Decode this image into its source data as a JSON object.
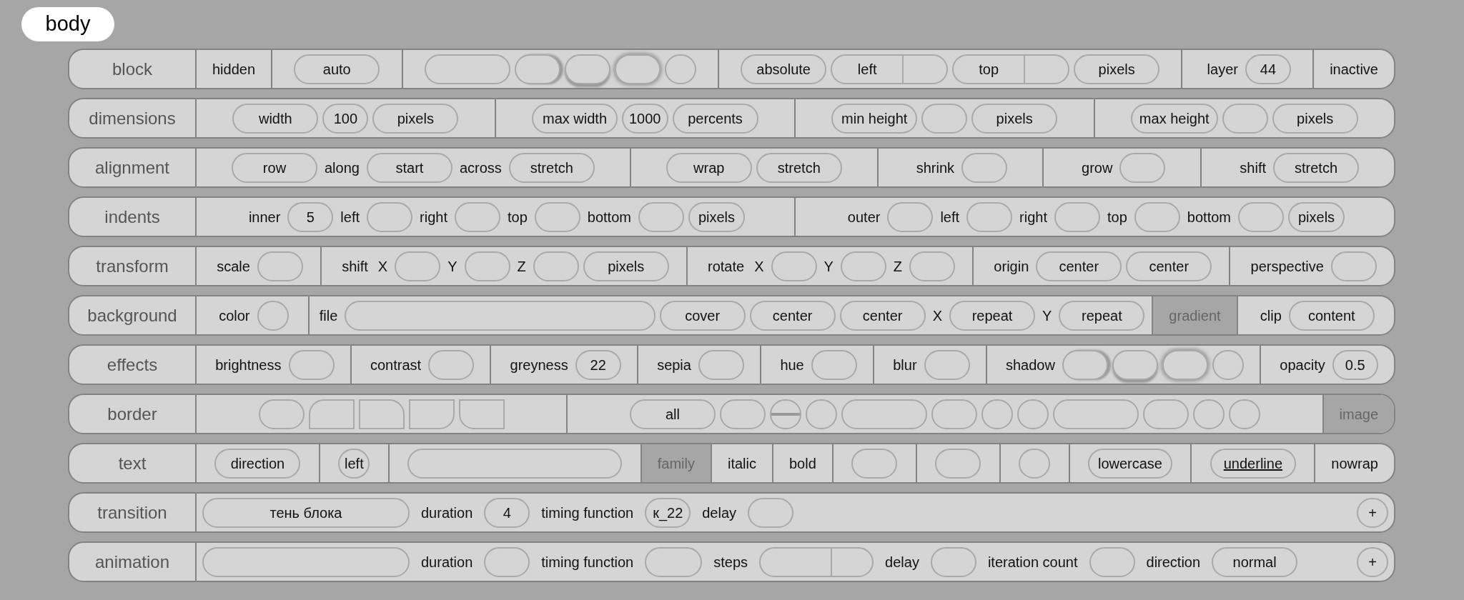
{
  "header": {
    "text": "body"
  },
  "rows": [
    {
      "label": "block",
      "sections": [
        {
          "kind": "toggle",
          "text": "hidden",
          "on": false
        },
        {
          "kind": "group",
          "items": [
            {
              "kind": "pill",
              "text": "auto"
            }
          ]
        },
        {
          "kind": "group",
          "items": [
            {
              "kind": "medium"
            },
            {
              "kind": "shadow-right"
            },
            {
              "kind": "shadow-below"
            },
            {
              "kind": "shadow-around"
            },
            {
              "kind": "dot"
            }
          ]
        },
        {
          "kind": "group",
          "items": [
            {
              "kind": "pill",
              "text": "absolute"
            },
            {
              "kind": "split",
              "text": "left"
            },
            {
              "kind": "split",
              "text": "top"
            },
            {
              "kind": "pill",
              "text": "pixels"
            }
          ]
        },
        {
          "kind": "group",
          "items": [
            {
              "kind": "text",
              "text": "layer"
            },
            {
              "kind": "short",
              "text": "44"
            }
          ]
        },
        {
          "kind": "toggle",
          "text": "inactive",
          "on": false
        }
      ]
    },
    {
      "label": "dimensions",
      "sections": [
        {
          "kind": "group",
          "items": [
            {
              "kind": "pill",
              "text": "width"
            },
            {
              "kind": "short",
              "text": "100"
            },
            {
              "kind": "pill",
              "text": "pixels"
            }
          ]
        },
        {
          "kind": "group",
          "items": [
            {
              "kind": "pill",
              "text": "max width"
            },
            {
              "kind": "short",
              "text": "1000"
            },
            {
              "kind": "pill",
              "text": "percents"
            }
          ]
        },
        {
          "kind": "group",
          "items": [
            {
              "kind": "pill",
              "text": "min height"
            },
            {
              "kind": "short"
            },
            {
              "kind": "pill",
              "text": "pixels"
            }
          ]
        },
        {
          "kind": "group",
          "items": [
            {
              "kind": "pill",
              "text": "max height"
            },
            {
              "kind": "short"
            },
            {
              "kind": "pill",
              "text": "pixels"
            }
          ]
        }
      ]
    },
    {
      "label": "alignment",
      "sections": [
        {
          "kind": "group",
          "items": [
            {
              "kind": "pill",
              "text": "row"
            },
            {
              "kind": "text",
              "text": "along"
            },
            {
              "kind": "pill",
              "text": "start"
            },
            {
              "kind": "text",
              "text": "across"
            },
            {
              "kind": "pill",
              "text": "stretch"
            }
          ]
        },
        {
          "kind": "group",
          "items": [
            {
              "kind": "pill",
              "text": "wrap"
            },
            {
              "kind": "pill",
              "text": "stretch"
            }
          ]
        },
        {
          "kind": "group",
          "items": [
            {
              "kind": "text",
              "text": "shrink"
            },
            {
              "kind": "short"
            }
          ]
        },
        {
          "kind": "group",
          "items": [
            {
              "kind": "text",
              "text": "grow"
            },
            {
              "kind": "short"
            }
          ]
        },
        {
          "kind": "group",
          "items": [
            {
              "kind": "text",
              "text": "shift"
            },
            {
              "kind": "pill",
              "text": "stretch"
            }
          ]
        }
      ]
    },
    {
      "label": "indents",
      "sections": [
        {
          "kind": "group",
          "items": [
            {
              "kind": "text",
              "text": "inner"
            },
            {
              "kind": "short",
              "text": "5"
            },
            {
              "kind": "text",
              "text": "left"
            },
            {
              "kind": "short"
            },
            {
              "kind": "text",
              "text": "right"
            },
            {
              "kind": "short"
            },
            {
              "kind": "text",
              "text": "top"
            },
            {
              "kind": "short"
            },
            {
              "kind": "text",
              "text": "bottom"
            },
            {
              "kind": "short"
            },
            {
              "kind": "chip",
              "text": "pixels"
            }
          ]
        },
        {
          "kind": "group",
          "items": [
            {
              "kind": "text",
              "text": "outer"
            },
            {
              "kind": "short"
            },
            {
              "kind": "text",
              "text": "left"
            },
            {
              "kind": "short"
            },
            {
              "kind": "text",
              "text": "right"
            },
            {
              "kind": "short"
            },
            {
              "kind": "text",
              "text": "top"
            },
            {
              "kind": "short"
            },
            {
              "kind": "text",
              "text": "bottom"
            },
            {
              "kind": "short"
            },
            {
              "kind": "chip",
              "text": "pixels"
            }
          ]
        }
      ]
    },
    {
      "label": "transform",
      "sections": [
        {
          "kind": "group",
          "items": [
            {
              "kind": "text",
              "text": "scale"
            },
            {
              "kind": "short"
            }
          ]
        },
        {
          "kind": "group",
          "items": [
            {
              "kind": "text",
              "text": "shift"
            },
            {
              "kind": "text",
              "text": "X"
            },
            {
              "kind": "short"
            },
            {
              "kind": "text",
              "text": "Y"
            },
            {
              "kind": "short"
            },
            {
              "kind": "text",
              "text": "Z"
            },
            {
              "kind": "short"
            },
            {
              "kind": "pill",
              "text": "pixels"
            }
          ]
        },
        {
          "kind": "group",
          "items": [
            {
              "kind": "text",
              "text": "rotate"
            },
            {
              "kind": "text",
              "text": "X"
            },
            {
              "kind": "short"
            },
            {
              "kind": "text",
              "text": "Y"
            },
            {
              "kind": "short"
            },
            {
              "kind": "text",
              "text": "Z"
            },
            {
              "kind": "short"
            }
          ]
        },
        {
          "kind": "group",
          "items": [
            {
              "kind": "text",
              "text": "origin"
            },
            {
              "kind": "pill",
              "text": "center"
            },
            {
              "kind": "pill",
              "text": "center"
            }
          ]
        },
        {
          "kind": "group",
          "items": [
            {
              "kind": "text",
              "text": "perspective"
            },
            {
              "kind": "short"
            }
          ]
        }
      ]
    },
    {
      "label": "background",
      "sections": [
        {
          "kind": "group",
          "items": [
            {
              "kind": "text",
              "text": "color"
            },
            {
              "kind": "dot"
            }
          ]
        },
        {
          "kind": "group",
          "items": [
            {
              "kind": "text",
              "text": "file"
            },
            {
              "kind": "xl"
            },
            {
              "kind": "pill",
              "text": "cover"
            },
            {
              "kind": "pill",
              "text": "center"
            },
            {
              "kind": "pill",
              "text": "center"
            },
            {
              "kind": "text",
              "text": "X"
            },
            {
              "kind": "pill",
              "text": "repeat"
            },
            {
              "kind": "text",
              "text": "Y"
            },
            {
              "kind": "pill",
              "text": "repeat"
            }
          ]
        },
        {
          "kind": "toggle",
          "text": "gradient",
          "on": true
        },
        {
          "kind": "group",
          "items": [
            {
              "kind": "text",
              "text": "clip"
            },
            {
              "kind": "pill",
              "text": "content"
            }
          ]
        }
      ]
    },
    {
      "label": "effects",
      "sections": [
        {
          "kind": "group",
          "items": [
            {
              "kind": "text",
              "text": "brightness"
            },
            {
              "kind": "short"
            }
          ]
        },
        {
          "kind": "group",
          "items": [
            {
              "kind": "text",
              "text": "contrast"
            },
            {
              "kind": "short"
            }
          ]
        },
        {
          "kind": "group",
          "items": [
            {
              "kind": "text",
              "text": "greyness"
            },
            {
              "kind": "short",
              "text": "22"
            }
          ]
        },
        {
          "kind": "group",
          "items": [
            {
              "kind": "text",
              "text": "sepia"
            },
            {
              "kind": "short"
            }
          ]
        },
        {
          "kind": "group",
          "items": [
            {
              "kind": "text",
              "text": "hue"
            },
            {
              "kind": "short"
            }
          ]
        },
        {
          "kind": "group",
          "items": [
            {
              "kind": "text",
              "text": "blur"
            },
            {
              "kind": "short"
            }
          ]
        },
        {
          "kind": "group",
          "items": [
            {
              "kind": "text",
              "text": "shadow"
            },
            {
              "kind": "shadow-right"
            },
            {
              "kind": "shadow-below"
            },
            {
              "kind": "shadow-around"
            },
            {
              "kind": "dot"
            }
          ]
        },
        {
          "kind": "group",
          "items": [
            {
              "kind": "text",
              "text": "opacity"
            },
            {
              "kind": "short",
              "text": "0.5"
            }
          ]
        }
      ]
    },
    {
      "label": "border",
      "sections": [
        {
          "kind": "group",
          "items": [
            {
              "kind": "corner-rounded"
            },
            {
              "kind": "corner-top-left"
            },
            {
              "kind": "corner-top-right"
            },
            {
              "kind": "corner-bottom-right"
            },
            {
              "kind": "corner-bottom-left"
            }
          ]
        },
        {
          "kind": "group",
          "items": [
            {
              "kind": "pill",
              "text": "all"
            },
            {
              "kind": "short"
            },
            {
              "kind": "dot-line"
            },
            {
              "kind": "dot"
            },
            {
              "kind": "medium"
            },
            {
              "kind": "short"
            },
            {
              "kind": "dot"
            },
            {
              "kind": "dot"
            },
            {
              "kind": "medium"
            },
            {
              "kind": "short"
            },
            {
              "kind": "dot"
            },
            {
              "kind": "dot"
            }
          ]
        },
        {
          "kind": "toggle",
          "text": "image",
          "on": true
        }
      ]
    },
    {
      "label": "text",
      "sections": [
        {
          "kind": "group",
          "items": [
            {
              "kind": "pill",
              "text": "direction"
            }
          ]
        },
        {
          "kind": "group",
          "items": [
            {
              "kind": "dot",
              "text": "left"
            }
          ]
        },
        {
          "kind": "group",
          "items": [
            {
              "kind": "long"
            }
          ]
        },
        {
          "kind": "toggle",
          "text": "family",
          "on": true
        },
        {
          "kind": "toggle",
          "text": "italic",
          "on": false
        },
        {
          "kind": "toggle",
          "text": "bold",
          "on": false
        },
        {
          "kind": "group",
          "items": [
            {
              "kind": "short"
            }
          ]
        },
        {
          "kind": "group",
          "items": [
            {
              "kind": "short"
            }
          ]
        },
        {
          "kind": "group",
          "items": [
            {
              "kind": "dot"
            }
          ]
        },
        {
          "kind": "group",
          "items": [
            {
              "kind": "chip",
              "text": "lowercase"
            }
          ]
        },
        {
          "kind": "group",
          "items": [
            {
              "kind": "pill",
              "text": "underline",
              "underline": true
            }
          ]
        },
        {
          "kind": "toggle",
          "text": "nowrap",
          "on": false
        }
      ]
    },
    {
      "label": "transition",
      "sections": [
        {
          "kind": "group",
          "items": [
            {
              "kind": "long",
              "text": "тень блока"
            },
            {
              "kind": "text",
              "text": "duration"
            },
            {
              "kind": "short",
              "text": "4"
            },
            {
              "kind": "text",
              "text": "timing function"
            },
            {
              "kind": "short",
              "text": "к_22"
            },
            {
              "kind": "text",
              "text": "delay"
            },
            {
              "kind": "short"
            },
            {
              "kind": "plus",
              "text": "+"
            }
          ]
        }
      ]
    },
    {
      "label": "animation",
      "sections": [
        {
          "kind": "group",
          "items": [
            {
              "kind": "long"
            },
            {
              "kind": "text",
              "text": "duration"
            },
            {
              "kind": "short"
            },
            {
              "kind": "text",
              "text": "timing function"
            },
            {
              "kind": "medium"
            },
            {
              "kind": "text",
              "text": "steps"
            },
            {
              "kind": "split"
            },
            {
              "kind": "text",
              "text": "delay"
            },
            {
              "kind": "short"
            },
            {
              "kind": "text",
              "text": "iteration count"
            },
            {
              "kind": "short"
            },
            {
              "kind": "text",
              "text": "direction"
            },
            {
              "kind": "pill",
              "text": "normal"
            },
            {
              "kind": "plus",
              "text": "+"
            }
          ]
        }
      ]
    }
  ]
}
